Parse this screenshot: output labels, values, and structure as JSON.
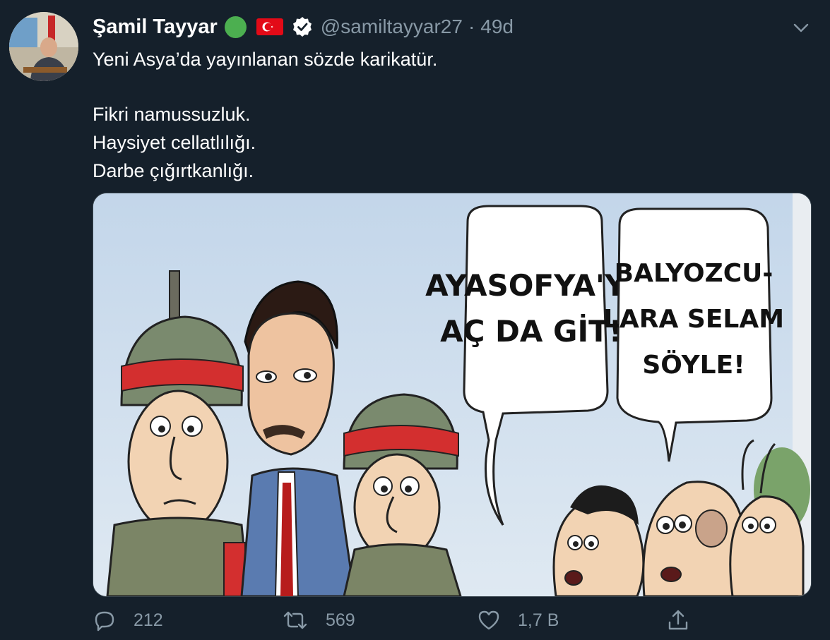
{
  "author": {
    "display_name": "Şamil Tayyar",
    "handle": "@samiltayyar27",
    "time": "49d",
    "separator": "·",
    "avatar_icon": "avatar",
    "badges": [
      "green-circle-emoji",
      "turkey-flag-emoji",
      "verified-icon"
    ]
  },
  "tweet": {
    "lines_block1": [
      "Yeni Asya’da yayınlanan sözde karikatür."
    ],
    "lines_block2": [
      "Fikri namussuzluk.",
      "Haysiyet cellatlılığı.",
      "Darbe çığırtkanlığı."
    ]
  },
  "media": {
    "bubble1": [
      "AYASOFYA'YI",
      "AÇ DA GİT!"
    ],
    "bubble2": [
      "BALYOZCU-",
      "LARA SELAM",
      "SÖYLE!"
    ]
  },
  "actions": {
    "reply_count": "212",
    "retweet_count": "569",
    "like_count": "1,7 B"
  },
  "colors": {
    "background": "#15202b",
    "secondary_text": "#8899a6",
    "border": "#38444d"
  }
}
